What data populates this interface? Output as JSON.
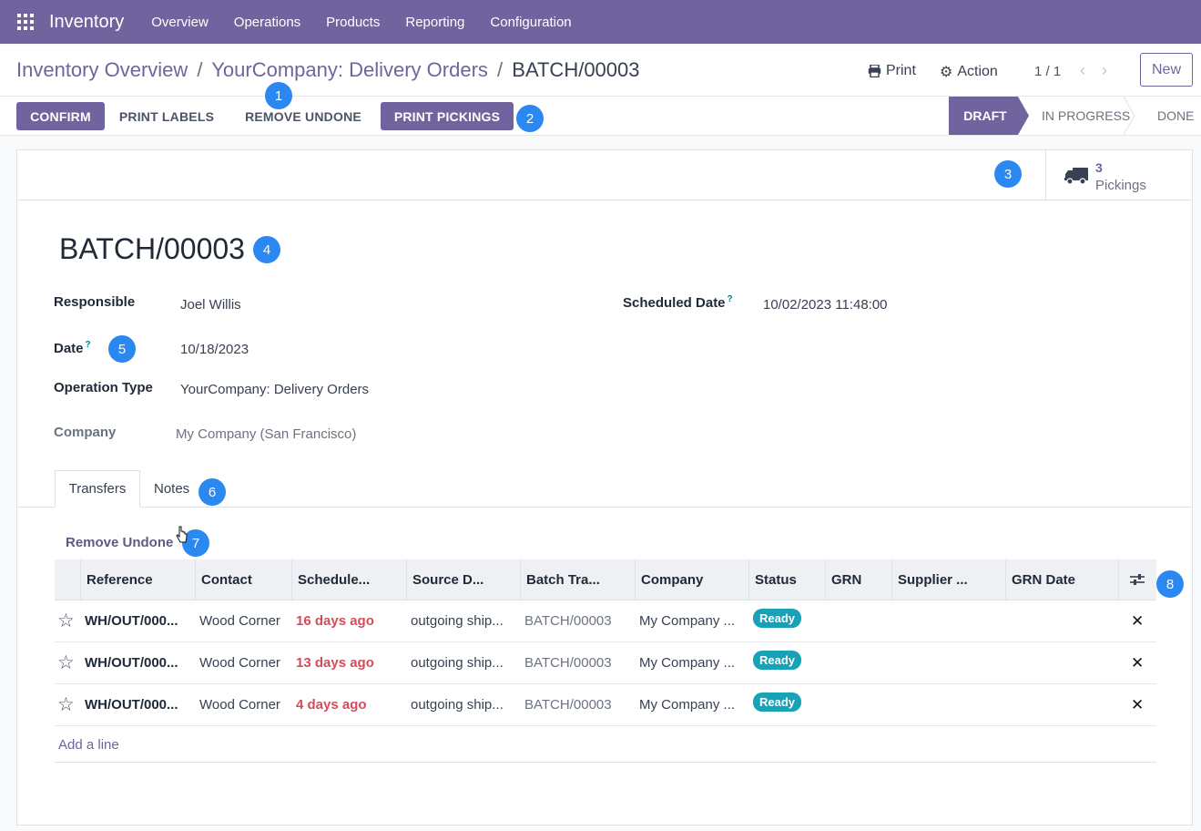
{
  "topbar": {
    "app_name": "Inventory",
    "menu": [
      "Overview",
      "Operations",
      "Products",
      "Reporting",
      "Configuration"
    ]
  },
  "breadcrumb": {
    "items": [
      "Inventory Overview",
      "YourCompany: Delivery Orders",
      "BATCH/00003"
    ],
    "separator": "/"
  },
  "control_panel": {
    "print_label": "Print",
    "action_label": "Action",
    "pager": "1 / 1",
    "new_label": "New"
  },
  "header_buttons": {
    "confirm": "CONFIRM",
    "print_labels": "PRINT LABELS",
    "remove_undone": "REMOVE UNDONE",
    "print_pickings": "PRINT PICKINGS"
  },
  "statusbar": {
    "stages": [
      "DRAFT",
      "IN PROGRESS",
      "DONE"
    ],
    "active": "DRAFT"
  },
  "smart_button": {
    "value": "3",
    "label": "Pickings",
    "icon": "truck-icon"
  },
  "record": {
    "title": "BATCH/00003",
    "fields": {
      "responsible_label": "Responsible",
      "responsible_value": "Joel Willis",
      "date_label": "Date",
      "date_value": "10/18/2023",
      "operation_type_label": "Operation Type",
      "operation_type_value": "YourCompany: Delivery Orders",
      "company_label": "Company",
      "company_value": "My Company (San Francisco)",
      "scheduled_date_label": "Scheduled Date",
      "scheduled_date_value": "10/02/2023 11:48:00",
      "help_mark": "?"
    }
  },
  "tabs": [
    "Transfers",
    "Notes"
  ],
  "transfers": {
    "remove_undone_link": "Remove Undone",
    "columns": [
      "Reference",
      "Contact",
      "Schedule...",
      "Source D...",
      "Batch Tra...",
      "Company",
      "Status",
      "GRN",
      "Supplier ...",
      "GRN Date"
    ],
    "rows": [
      {
        "reference": "WH/OUT/000...",
        "contact": "Wood Corner",
        "scheduled": "16 days ago",
        "source": "outgoing ship...",
        "batch": "BATCH/00003",
        "company": "My Company ...",
        "status": "Ready"
      },
      {
        "reference": "WH/OUT/000...",
        "contact": "Wood Corner",
        "scheduled": "13 days ago",
        "source": "outgoing ship...",
        "batch": "BATCH/00003",
        "company": "My Company ...",
        "status": "Ready"
      },
      {
        "reference": "WH/OUT/000...",
        "contact": "Wood Corner",
        "scheduled": "4 days ago",
        "source": "outgoing ship...",
        "batch": "BATCH/00003",
        "company": "My Company ...",
        "status": "Ready"
      }
    ],
    "add_line": "Add a line"
  },
  "markers": [
    "1",
    "2",
    "3",
    "4",
    "5",
    "6",
    "7",
    "8"
  ],
  "colors": {
    "brand": "#71639e",
    "late": "#d44c59",
    "badge": "#17a2b8",
    "marker": "#2b88f0"
  }
}
